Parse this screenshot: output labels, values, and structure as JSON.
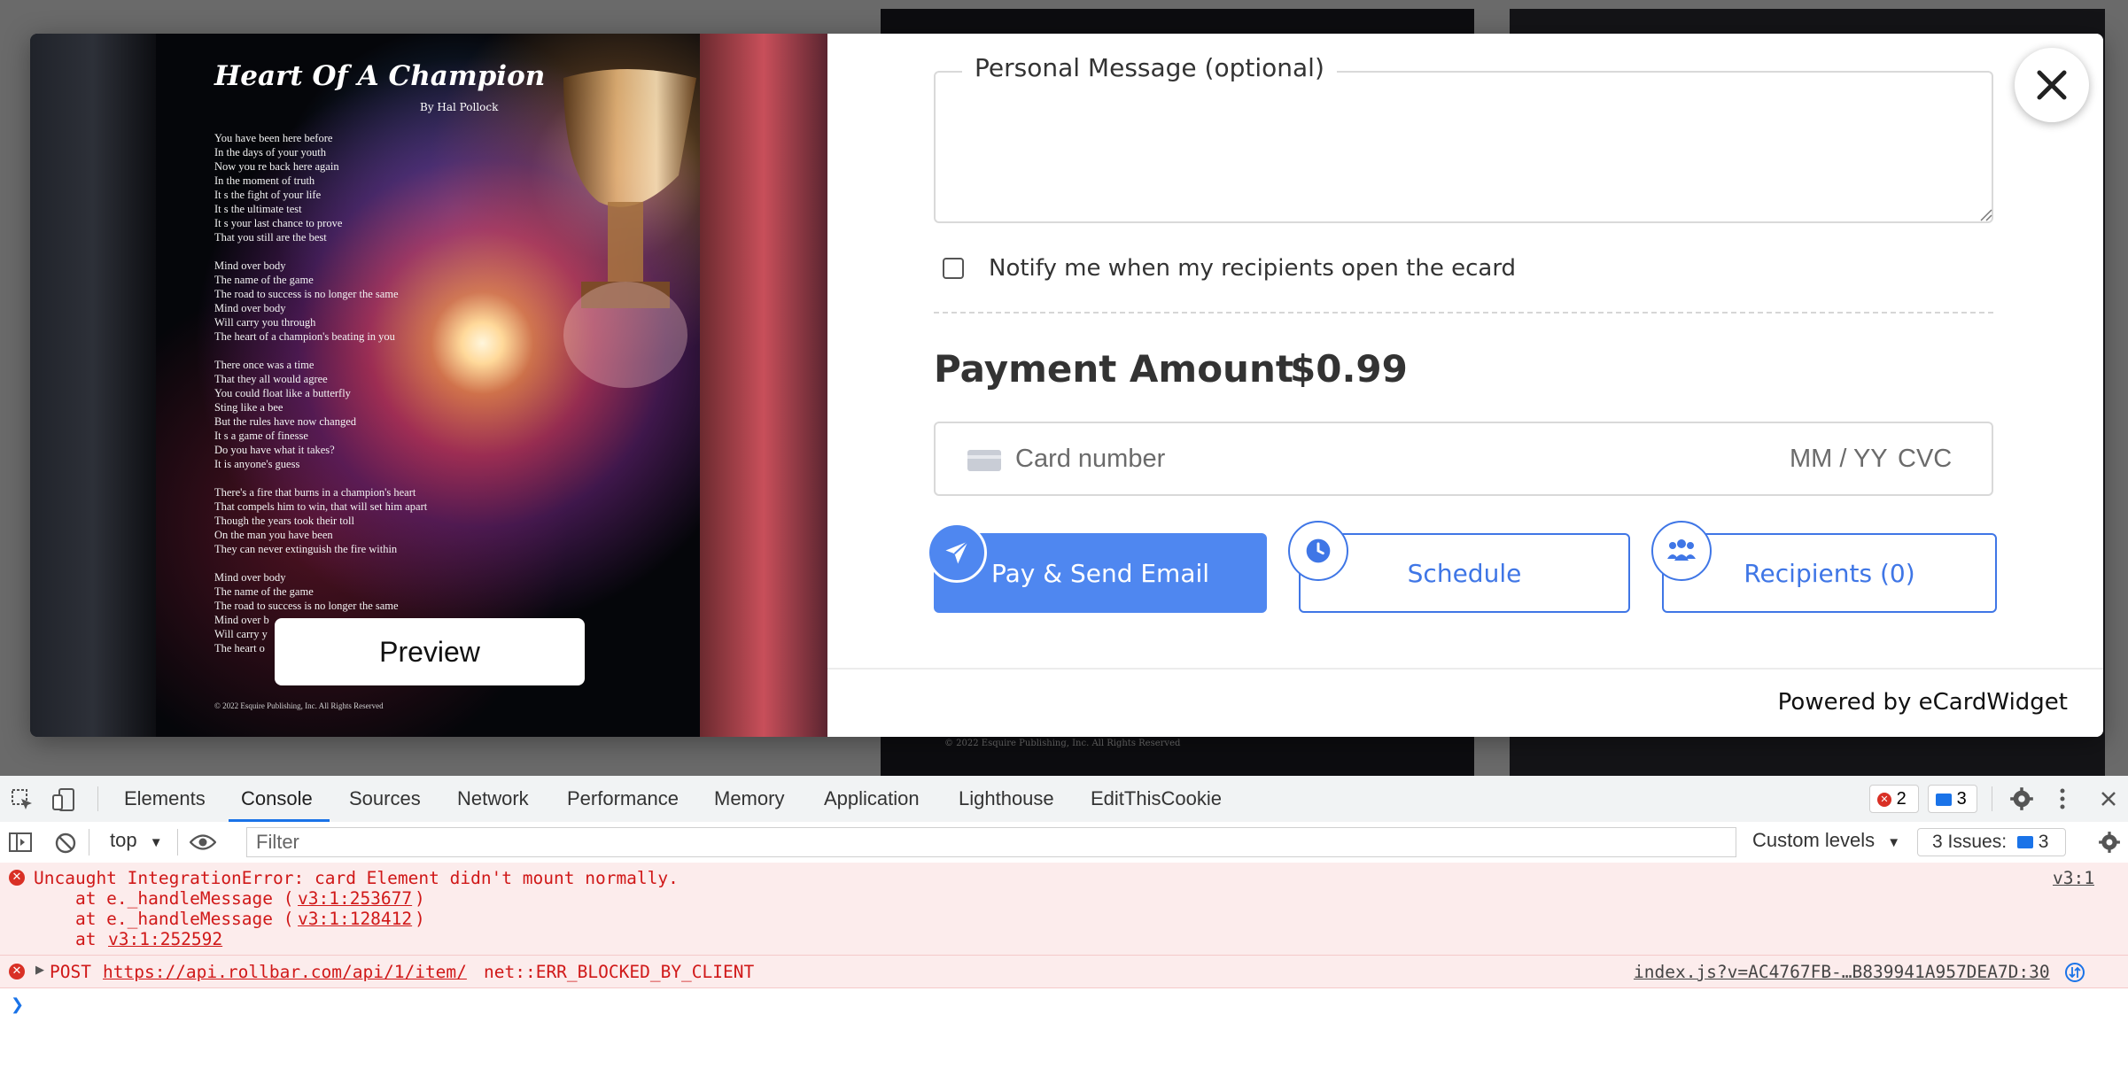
{
  "poster": {
    "title": "Heart Of A Champion",
    "author": "By Hal Pollock",
    "stanzas": [
      [
        "You have been here before",
        "In the days of your youth",
        "Now you re back here again",
        "In the moment of truth",
        "It s the fight of your life",
        "It s the ultimate test",
        "It s your last chance to prove",
        "That you still are the best"
      ],
      [
        "Mind over body",
        "The name of the game",
        "The road to success is no longer the same",
        "Mind over body",
        "Will carry you through",
        "The heart of a champion's beating in you"
      ],
      [
        "There once was a time",
        "That they all would agree",
        "You could float like a butterfly",
        "Sting like a bee",
        "But the rules have now changed",
        "It s a game of finesse",
        "Do you have what it takes?",
        "It is anyone's guess"
      ],
      [
        "There's a fire that burns in a champion's heart",
        "That compels him to win, that will set him apart",
        "Though the years took their toll",
        "On the man you have been",
        "They can never extinguish the fire within"
      ],
      [
        "Mind over body",
        "The name of the game",
        "The road to success is no longer the same",
        "Mind over b",
        "Will carry y",
        "The heart o"
      ]
    ],
    "copyright": "© 2022 Esquire Publishing, Inc. All Rights Reserved",
    "preview_label": "Preview"
  },
  "background": {
    "copyright": "© 2022 Esquire Publishing, Inc. All Rights Reserved"
  },
  "form": {
    "message_legend": "Personal Message (optional)",
    "message_value": "",
    "notify_label": "Notify me when my recipients open the ecard",
    "notify_checked": false,
    "payment_label": "Payment Amount",
    "payment_amount": "$0.99",
    "card": {
      "number_placeholder": "Card number",
      "exp_placeholder": "MM / YY",
      "cvc_placeholder": "CVC"
    },
    "buttons": {
      "pay_send": "Pay & Send Email",
      "schedule": "Schedule",
      "recipients": "Recipients (0)"
    },
    "powered_by": "Powered by eCardWidget"
  },
  "devtools": {
    "tabs": [
      "Elements",
      "Console",
      "Sources",
      "Network",
      "Performance",
      "Memory",
      "Application",
      "Lighthouse",
      "EditThisCookie"
    ],
    "active_tab": "Console",
    "error_count": "2",
    "message_count": "3",
    "context": "top",
    "filter_placeholder": "Filter",
    "levels": "Custom levels",
    "issues_label": "3 Issues:",
    "issues_count": "3",
    "errors": {
      "e1_message": "Uncaught IntegrationError: card Element didn't mount normally.",
      "e1_source": "v3:1",
      "stack1_prefix": "    at e._handleMessage (",
      "stack1_link": "v3:1:253677",
      "stack2_prefix": "    at e._handleMessage (",
      "stack2_link": "v3:1:128412",
      "stack3_prefix": "    at ",
      "stack3_link": "v3:1:252592",
      "close_paren": ")",
      "e2_method": "POST",
      "e2_url": "https://api.rollbar.com/api/1/item/",
      "e2_error": "net::ERR_BLOCKED_BY_CLIENT",
      "e2_source": "index.js?v=AC4767FB-…B839941A957DEA7D:30"
    }
  },
  "colors": {
    "accent": "#4f87f0",
    "accent_border": "#3f76e6",
    "error_red": "#d01818",
    "error_bg": "#fcecec"
  }
}
